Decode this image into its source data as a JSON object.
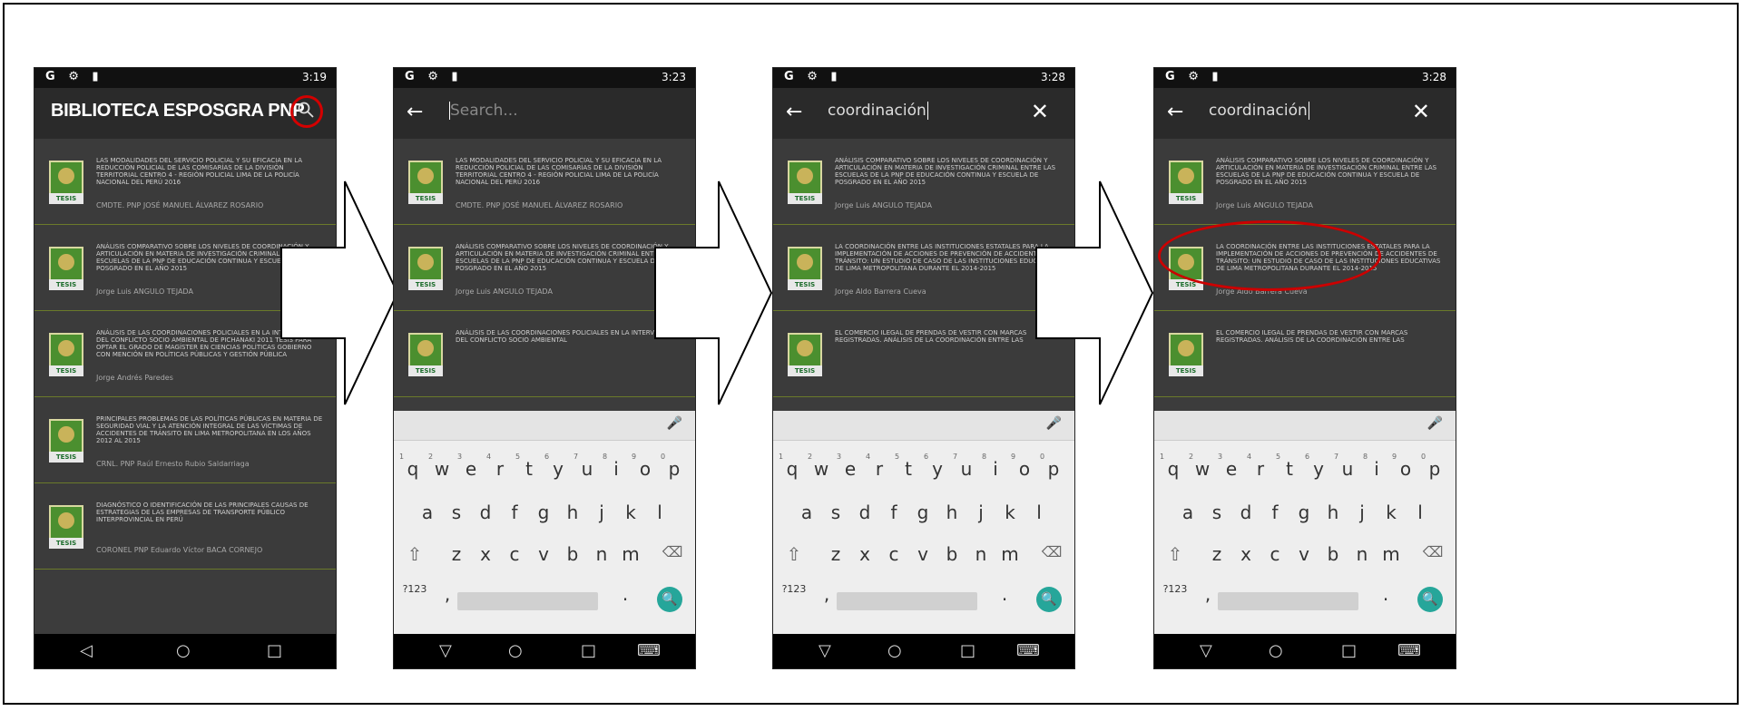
{
  "status_time": [
    "3:19",
    "3:23",
    "3:28",
    "3:28"
  ],
  "status_left": "G ⚙ ▮",
  "status_right_icons": "● ▾▮",
  "app_title": "BIBLIOTECA ESPOSGRA PNP",
  "search_placeholder": "Search...",
  "search_query": "coordinación",
  "thumb_tag": "TESIS",
  "list1": [
    {
      "title": "LAS MODALIDADES DEL SERVICIO POLICIAL Y SU EFICACIA EN LA REDUCCIÓN POLICIAL DE LAS COMISARÍAS DE LA DIVISIÓN TERRITORIAL CENTRO 4 - REGIÓN POLICIAL LIMA DE LA POLICÍA NACIONAL DEL PERÚ 2016",
      "author": "CMDTE. PNP JOSÉ MANUEL ÁLVAREZ ROSARIO"
    },
    {
      "title": "ANÁLISIS COMPARATIVO SOBRE LOS NIVELES DE COORDINACIÓN Y ARTICULACIÓN EN MATERIA DE INVESTIGACIÓN CRIMINAL ENTRE LAS ESCUELAS DE LA PNP DE EDUCACIÓN CONTINUA Y ESCUELA DE POSGRADO EN EL AÑO 2015",
      "author": "Jorge Luis ANGULO TEJADA"
    },
    {
      "title": "ANÁLISIS DE LAS COORDINACIONES POLICIALES EN LA INTERVENCIÓN DEL CONFLICTO SOCIO AMBIENTAL DE PICHANAKI 2011 TESIS PARA OPTAR EL GRADO DE MAGÍSTER EN CIENCIAS POLÍTICAS GOBIERNO CON MENCIÓN EN POLÍTICAS PÚBLICAS Y GESTIÓN PÚBLICA",
      "author": "Jorge Andrés Paredes"
    },
    {
      "title": "PRINCIPALES PROBLEMAS DE LAS POLÍTICAS PÚBLICAS EN MATERIA DE SEGURIDAD VIAL Y LA ATENCIÓN INTEGRAL DE LAS VÍCTIMAS DE ACCIDENTES DE TRÁNSITO EN LIMA METROPOLITANA EN LOS AÑOS 2012 AL 2015",
      "author": "CRNL. PNP Raúl Ernesto Rubio Saldarriaga"
    },
    {
      "title": "DIAGNÓSTICO O IDENTIFICACIÓN DE LAS PRINCIPALES CAUSAS DE ESTRATEGIAS DE LAS EMPRESAS DE TRANSPORTE PÚBLICO INTERPROVINCIAL EN PERÚ",
      "author": "CORONEL PNP Eduardo Víctor BACA CORNEJO"
    }
  ],
  "list2": [
    {
      "title": "LAS MODALIDADES DEL SERVICIO POLICIAL Y SU EFICACIA EN LA REDUCCIÓN POLICIAL DE LAS COMISARÍAS DE LA DIVISIÓN TERRITORIAL CENTRO 4 - REGIÓN POLICIAL LIMA DE LA POLICÍA NACIONAL DEL PERÚ 2016",
      "author": "CMDTE. PNP JOSÉ MANUEL ÁLVAREZ ROSARIO"
    },
    {
      "title": "ANÁLISIS COMPARATIVO SOBRE LOS NIVELES DE COORDINACIÓN Y ARTICULACIÓN EN MATERIA DE INVESTIGACIÓN CRIMINAL ENTRE LAS ESCUELAS DE LA PNP DE EDUCACIÓN CONTINUA Y ESCUELA DE POSGRADO EN EL AÑO 2015",
      "author": "Jorge Luis ANGULO TEJADA"
    },
    {
      "title": "ANÁLISIS DE LAS COORDINACIONES POLICIALES EN LA INTERVENCIÓN DEL CONFLICTO SOCIO AMBIENTAL",
      "author": ""
    }
  ],
  "list3": [
    {
      "title": "ANÁLISIS COMPARATIVO SOBRE LOS NIVELES DE COORDINACIÓN Y ARTICULACIÓN EN MATERIA DE INVESTIGACIÓN CRIMINAL ENTRE LAS ESCUELAS DE LA PNP DE EDUCACIÓN CONTINUA Y ESCUELA DE POSGRADO EN EL AÑO 2015",
      "author": "Jorge Luis ANGULO TEJADA"
    },
    {
      "title": "LA COORDINACIÓN ENTRE LAS INSTITUCIONES ESTATALES PARA LA IMPLEMENTACIÓN DE ACCIONES DE PREVENCIÓN DE ACCIDENTES DE TRÁNSITO: UN ESTUDIO DE CASO DE LAS INSTITUCIONES EDUCATIVAS DE LIMA METROPOLITANA DURANTE EL 2014-2015",
      "author": "Jorge Aldo Barrera Cueva"
    },
    {
      "title": "EL COMERCIO ILEGAL DE PRENDAS DE VESTIR CON MARCAS REGISTRADAS. ANÁLISIS DE LA COORDINACIÓN ENTRE LAS",
      "author": ""
    }
  ],
  "keyboard": {
    "row1": [
      "q",
      "w",
      "e",
      "r",
      "t",
      "y",
      "u",
      "i",
      "o",
      "p"
    ],
    "row1_nums": [
      "1",
      "2",
      "3",
      "4",
      "5",
      "6",
      "7",
      "8",
      "9",
      "0"
    ],
    "row2": [
      "a",
      "s",
      "d",
      "f",
      "g",
      "h",
      "j",
      "k",
      "l"
    ],
    "row3": [
      "z",
      "x",
      "c",
      "v",
      "b",
      "n",
      "m"
    ],
    "symbols": "?123",
    "comma": ",",
    "period": "."
  },
  "nav": {
    "back": "◁",
    "home": "○",
    "recents": "□"
  },
  "nav_kb": {
    "back": "▽",
    "home": "○",
    "recents": "□",
    "kbd": "⌨"
  }
}
